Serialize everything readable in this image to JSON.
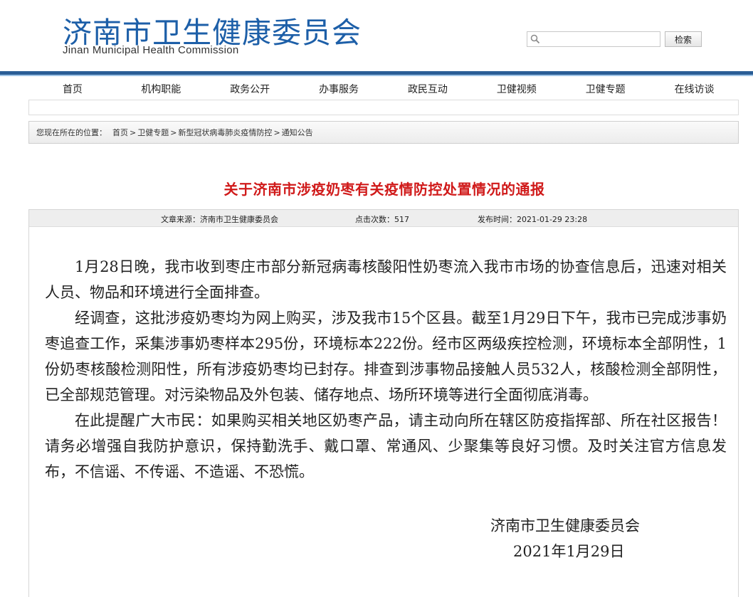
{
  "header": {
    "logo_cn": "济南市卫生健康委员会",
    "logo_en": "Jinan Municipal Health Commission",
    "search": {
      "placeholder": "",
      "button_label": "检索",
      "icon": "search-icon"
    },
    "accent_color": "#1d5fa8",
    "bar_color": "#2a5e96"
  },
  "nav": {
    "items": [
      {
        "label": "首页"
      },
      {
        "label": "机构职能"
      },
      {
        "label": "政务公开"
      },
      {
        "label": "办事服务"
      },
      {
        "label": "政民互动"
      },
      {
        "label": "卫健视频"
      },
      {
        "label": "卫健专题"
      },
      {
        "label": "在线访谈"
      }
    ]
  },
  "breadcrumb": {
    "prefix": "您现在所在的位置：",
    "items": [
      {
        "label": "首页"
      },
      {
        "label": "卫健专题"
      },
      {
        "label": "新型冠状病毒肺炎疫情防控"
      },
      {
        "label": "通知公告"
      }
    ],
    "separator": ">"
  },
  "article": {
    "title": "关于济南市涉疫奶枣有关疫情防控处置情况的通报",
    "title_color": "#d01a1a",
    "meta": {
      "source": "文章来源：济南市卫生健康委员会",
      "clicks": "点击次数：517",
      "published": "发布时间：2021-01-29 23:28"
    },
    "paragraphs": [
      "1月28日晚，我市收到枣庄市部分新冠病毒核酸阳性奶枣流入我市市场的协查信息后，迅速对相关人员、物品和环境进行全面排查。",
      "经调查，这批涉疫奶枣均为网上购买，涉及我市15个区县。截至1月29日下午，我市已完成涉事奶枣追查工作，采集涉事奶枣样本295份，环境标本222份。经市区两级疾控检测，环境标本全部阴性，1份奶枣核酸检测阳性，所有涉疫奶枣均已封存。排查到涉事物品接触人员532人，核酸检测全部阴性，已全部规范管理。对污染物品及外包装、储存地点、场所环境等进行全面彻底消毒。",
      "在此提醒广大市民：如果购买相关地区奶枣产品，请主动向所在辖区防疫指挥部、所在社区报告！请务必增强自我防护意识，保持勤洗手、戴口罩、常通风、少聚集等良好习惯。及时关注官方信息发布，不信谣、不传谣、不造谣、不恐慌。"
    ],
    "signature_org": "济南市卫生健康委员会",
    "signature_date": "2021年1月29日"
  }
}
